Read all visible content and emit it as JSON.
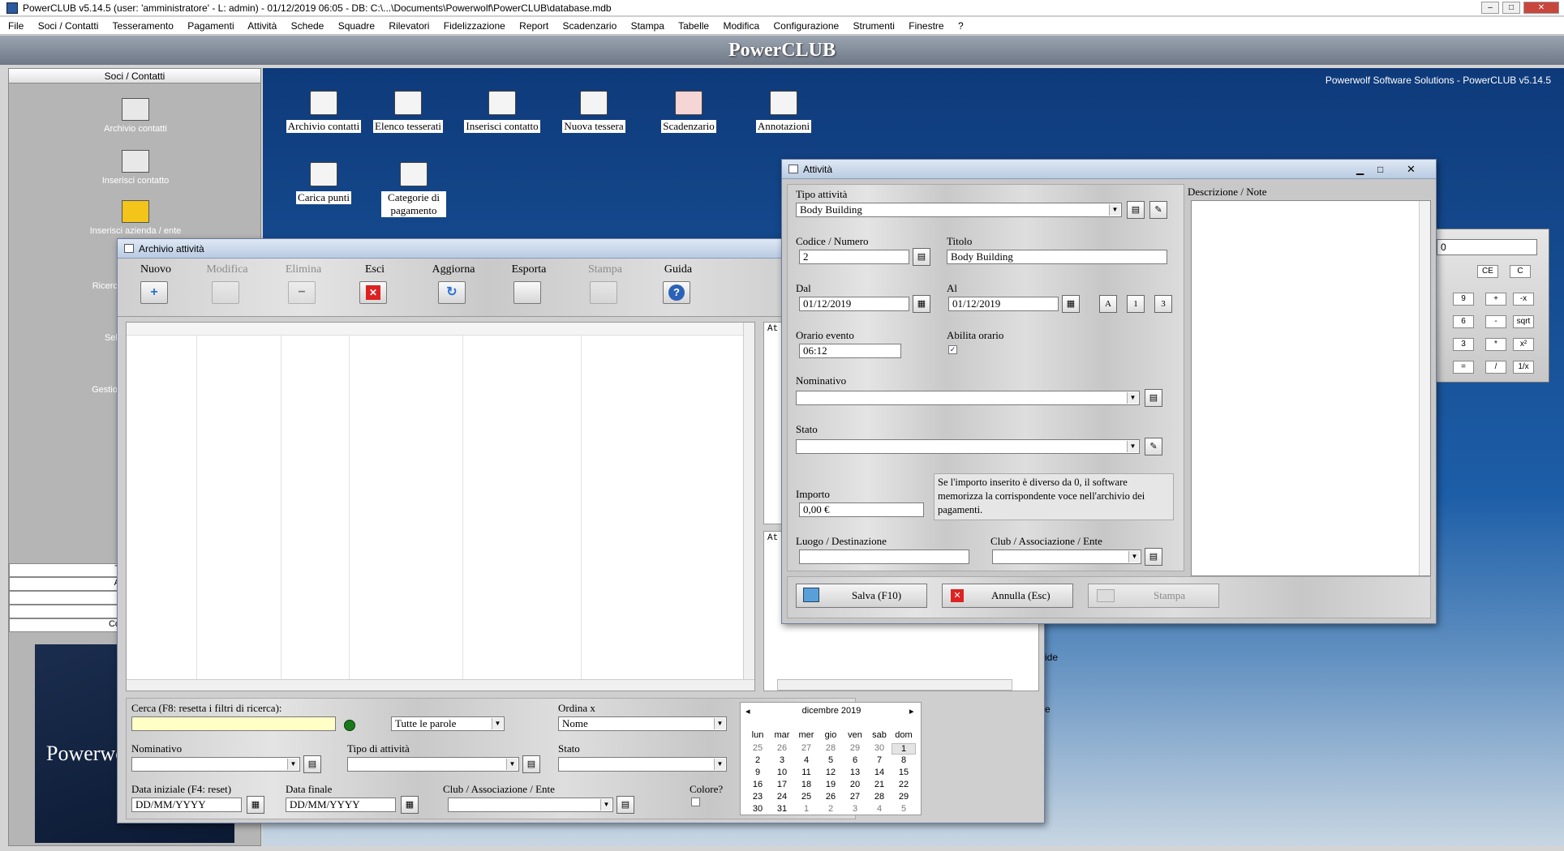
{
  "window": {
    "title": "PowerCLUB v5.14.5  (user: 'amministratore'  - L: admin) - 01/12/2019 06:05 - DB: C:\\...\\Documents\\Powerwolf\\PowerCLUB\\database.mdb",
    "controls": [
      "–",
      "□",
      "✕"
    ]
  },
  "menu": [
    "File",
    "Soci / Contatti",
    "Tesseramento",
    "Pagamenti",
    "Attività",
    "Schede",
    "Squadre",
    "Rilevatori",
    "Fidelizzazione",
    "Report",
    "Scadenzario",
    "Stampa",
    "Tabelle",
    "Modifica",
    "Configurazione",
    "Strumenti",
    "Finestre",
    "?"
  ],
  "banner": "PowerCLUB",
  "sidebar": {
    "header": "Soci / Contatti",
    "items": [
      "Archivio contatti",
      "Inserisci contatto",
      "Inserisci azienda / ente",
      "Ricerca",
      "Sele",
      "Gestion"
    ],
    "bottom_rows": [
      "T",
      "A",
      "",
      "",
      "Co"
    ],
    "logo_text": "Powerwo"
  },
  "desktop": {
    "caption": "Powerwolf Software Solutions - PowerCLUB v5.14.5",
    "icons": [
      "Archivio contatti",
      "Elenco tesserati",
      "Inserisci contatto",
      "Nuova tessera",
      "Scadenzario",
      "Annotazioni",
      "Carica punti",
      "Categorie di pagamento"
    ],
    "bg_text": [
      "ide",
      "e"
    ]
  },
  "calculator": {
    "display": "0",
    "buttons": [
      "CE",
      "C",
      "9",
      "+",
      "-x",
      "6",
      "-",
      "sqrt",
      "3",
      "*",
      "x²",
      "=",
      "/",
      "1/x"
    ]
  },
  "archivio": {
    "title": "Archivio attività",
    "toolbar": [
      {
        "label": "Nuovo",
        "icon": "+",
        "enabled": true
      },
      {
        "label": "Modifica",
        "icon": "",
        "enabled": false
      },
      {
        "label": "Elimina",
        "icon": "−",
        "enabled": false
      },
      {
        "label": "Esci",
        "icon": "✕",
        "enabled": true
      },
      {
        "label": "Aggiorna",
        "icon": "↻",
        "enabled": true
      },
      {
        "label": "Esporta",
        "icon": "",
        "enabled": true
      },
      {
        "label": "Stampa",
        "icon": "",
        "enabled": false
      },
      {
        "label": "Guida",
        "icon": "?",
        "enabled": true
      }
    ],
    "side_labels": [
      "At",
      "At"
    ],
    "filters": {
      "cerca_label": "Cerca (F8: resetta i filtri di ricerca):",
      "cerca_value": "",
      "match_mode": "Tutte le parole",
      "ordina_label": "Ordina x",
      "ordina_value": "Nome",
      "nominativo_label": "Nominativo",
      "tipo_label": "Tipo di attività",
      "stato_label": "Stato",
      "data_iniziale_label": "Data iniziale (F4: reset)",
      "data_iniziale_value": "DD/MM/YYYY",
      "data_finale_label": "Data finale",
      "data_finale_value": "DD/MM/YYYY",
      "club_label": "Club / Associazione / Ente",
      "colore_label": "Colore?"
    },
    "calendar": {
      "month": "dicembre 2019",
      "prev": "◂",
      "next": "▸",
      "weekdays": [
        "lun",
        "mar",
        "mer",
        "gio",
        "ven",
        "sab",
        "dom"
      ],
      "weeks": [
        [
          "25",
          "26",
          "27",
          "28",
          "29",
          "30",
          "1"
        ],
        [
          "2",
          "3",
          "4",
          "5",
          "6",
          "7",
          "8"
        ],
        [
          "9",
          "10",
          "11",
          "12",
          "13",
          "14",
          "15"
        ],
        [
          "16",
          "17",
          "18",
          "19",
          "20",
          "21",
          "22"
        ],
        [
          "23",
          "24",
          "25",
          "26",
          "27",
          "28",
          "29"
        ],
        [
          "30",
          "31",
          "1",
          "2",
          "3",
          "4",
          "5"
        ]
      ]
    }
  },
  "attivita": {
    "title": "Attività",
    "tipo_label": "Tipo attività",
    "tipo_value": "Body Building",
    "codice_label": "Codice / Numero",
    "codice_value": "2",
    "titolo_label": "Titolo",
    "titolo_value": "Body Building",
    "dal_label": "Dal",
    "dal_value": "01/12/2019",
    "al_label": "Al",
    "al_value": "01/12/2019",
    "quick_buttons": [
      "A",
      "1",
      "3"
    ],
    "orario_label": "Orario evento",
    "orario_value": "06:12",
    "abilita_label": "Abilita orario",
    "abilita_check": "✓",
    "nominativo_label": "Nominativo",
    "stato_label": "Stato",
    "importo_label": "Importo",
    "importo_value": "0,00 €",
    "importo_note": "Se l'importo inserito è diverso da 0, il software memorizza la corrispondente voce nell'archivio dei pagamenti.",
    "luogo_label": "Luogo / Destinazione",
    "club_label": "Club / Associazione / Ente",
    "descrizione_label": "Descrizione / Note",
    "salva_label": "Salva (F10)",
    "annulla_label": "Annulla (Esc)",
    "stampa_label": "Stampa"
  }
}
